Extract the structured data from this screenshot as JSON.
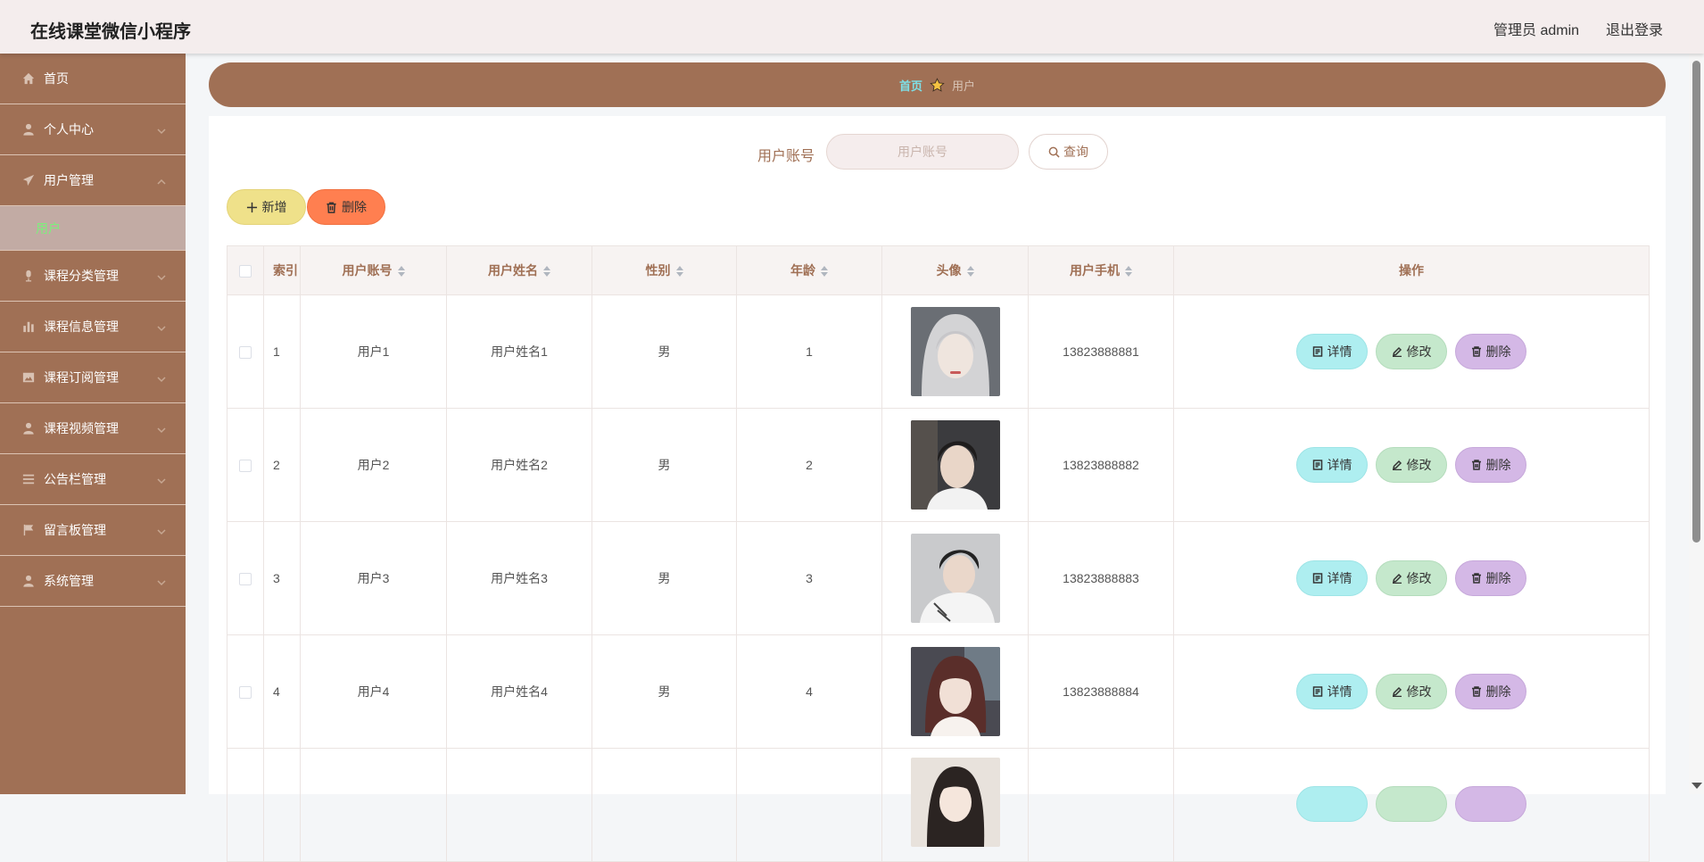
{
  "header": {
    "title": "在线课堂微信小程序",
    "admin": "管理员 admin",
    "logout": "退出登录"
  },
  "sidebar": {
    "items": [
      {
        "label": "首页",
        "icon": "home-icon"
      },
      {
        "label": "个人中心",
        "icon": "user-icon"
      },
      {
        "label": "用户管理",
        "icon": "send-icon",
        "expanded": true
      },
      {
        "label": "课程分类管理",
        "icon": "microphone-icon"
      },
      {
        "label": "课程信息管理",
        "icon": "bar-chart-icon"
      },
      {
        "label": "课程订阅管理",
        "icon": "picture-icon"
      },
      {
        "label": "课程视频管理",
        "icon": "user-icon"
      },
      {
        "label": "公告栏管理",
        "icon": "list-icon"
      },
      {
        "label": "留言板管理",
        "icon": "flag-icon"
      },
      {
        "label": "系统管理",
        "icon": "user-icon"
      }
    ],
    "sub_item": "用户"
  },
  "breadcrumb": {
    "home": "首页",
    "current": "用户"
  },
  "search": {
    "label": "用户账号",
    "placeholder": "用户账号",
    "button": "查询"
  },
  "toolbar": {
    "add": "新增",
    "delete": "删除"
  },
  "table": {
    "columns": [
      "索引",
      "用户账号",
      "用户姓名",
      "性别",
      "年龄",
      "头像",
      "用户手机",
      "操作"
    ],
    "rows": [
      {
        "index": "1",
        "account": "用户1",
        "name": "用户姓名1",
        "gender": "男",
        "age": "1",
        "phone": "13823888881"
      },
      {
        "index": "2",
        "account": "用户2",
        "name": "用户姓名2",
        "gender": "男",
        "age": "2",
        "phone": "13823888882"
      },
      {
        "index": "3",
        "account": "用户3",
        "name": "用户姓名3",
        "gender": "男",
        "age": "3",
        "phone": "13823888883"
      },
      {
        "index": "4",
        "account": "用户4",
        "name": "用户姓名4",
        "gender": "男",
        "age": "4",
        "phone": "13823888884"
      },
      {
        "index": "",
        "account": "",
        "name": "",
        "gender": "",
        "age": "",
        "phone": ""
      }
    ],
    "actions": {
      "detail": "详情",
      "edit": "修改",
      "remove": "删除"
    }
  },
  "colors": {
    "brand": "#a07055",
    "accent_active": "#7cf07c",
    "add_button": "#efe18a",
    "delete_button": "#ff7f50",
    "detail_button": "#aeeef0",
    "edit_button": "#c5e8cc",
    "remove_button": "#d4b8e6"
  }
}
